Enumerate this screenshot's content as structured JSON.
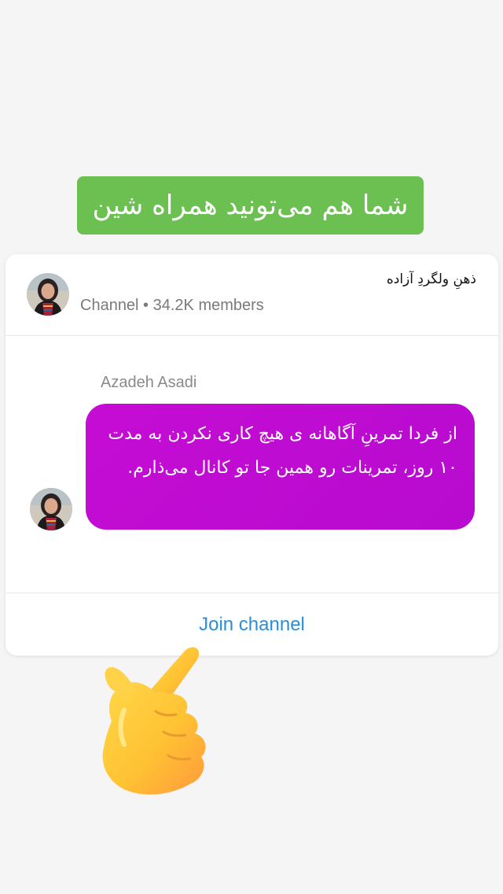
{
  "headline": {
    "text": "شما هم می‌تونید همراه شین",
    "bg_color": "#6cc052"
  },
  "channel": {
    "name": "ذهنِ ولگردِ آزاده",
    "meta": "Channel • 34.2K members",
    "avatar_icon": "profile-photo"
  },
  "message": {
    "sender": "Azadeh Asadi",
    "text": "از فردا تمرینِ آگاهانه ی هیچ کاری نکردن به مدت ۱۰ روز، تمرینات رو همین جا تو کانال می‌ذارم.",
    "bubble_color": "#c50cd4",
    "avatar_icon": "profile-photo"
  },
  "actions": {
    "join_label": "Join channel",
    "link_color": "#2a8ed8"
  },
  "decoration": {
    "icon": "pointing-hand-emoji"
  }
}
